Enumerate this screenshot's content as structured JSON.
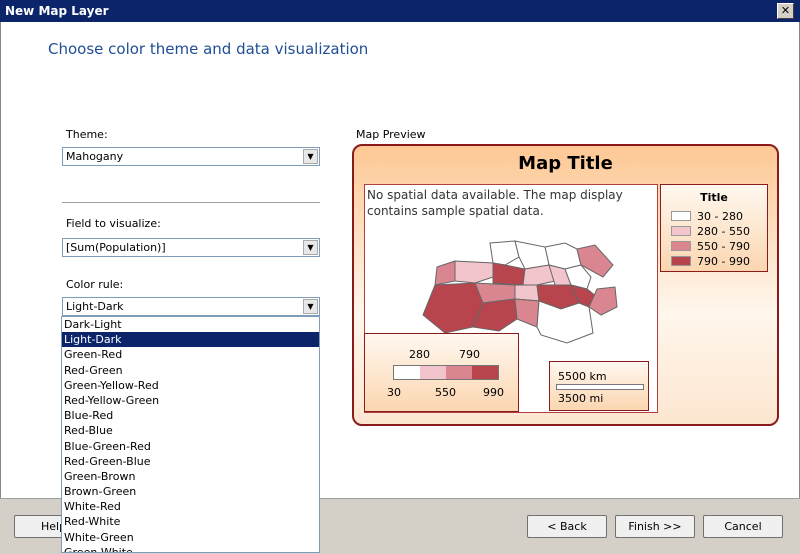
{
  "window": {
    "title": "New Map Layer",
    "close_glyph": "✕"
  },
  "heading": "Choose color theme and data visualization",
  "theme": {
    "label": "Theme:",
    "value": "Mahogany"
  },
  "field": {
    "label": "Field to visualize:",
    "value": "[Sum(Population)]"
  },
  "color_rule": {
    "label": "Color rule:",
    "value": "Light-Dark",
    "options": [
      "Dark-Light",
      "Light-Dark",
      "Green-Red",
      "Red-Green",
      "Green-Yellow-Red",
      "Red-Yellow-Green",
      "Blue-Red",
      "Red-Blue",
      "Blue-Green-Red",
      "Red-Green-Blue",
      "Green-Brown",
      "Brown-Green",
      "White-Red",
      "Red-White",
      "White-Green",
      "Green-White"
    ],
    "selected_index": 1
  },
  "preview": {
    "label": "Map Preview",
    "map_title": "Map Title",
    "no_data": "No spatial data available. The map display contains sample spatial data.",
    "legend": {
      "title": "Title",
      "items": [
        {
          "label": "30 - 280",
          "color": "#ffffff"
        },
        {
          "label": "280 - 550",
          "color": "#f2c5cc"
        },
        {
          "label": "550 - 790",
          "color": "#d98690"
        },
        {
          "label": "790 - 990",
          "color": "#b8454d"
        }
      ]
    },
    "color_scale": {
      "top_labels": [
        "280",
        "790"
      ],
      "bottom_labels": [
        "30",
        "550",
        "990"
      ]
    },
    "distance_scale": {
      "km": "5500 km",
      "mi": "3500 mi"
    }
  },
  "buttons": {
    "help": "Help",
    "back": "< Back",
    "finish": "Finish >>",
    "cancel": "Cancel"
  },
  "colors": {
    "titlebar": "#0b246a",
    "heading": "#1f4e96",
    "border": "#8b1a1a",
    "selection": "#0b246a"
  }
}
